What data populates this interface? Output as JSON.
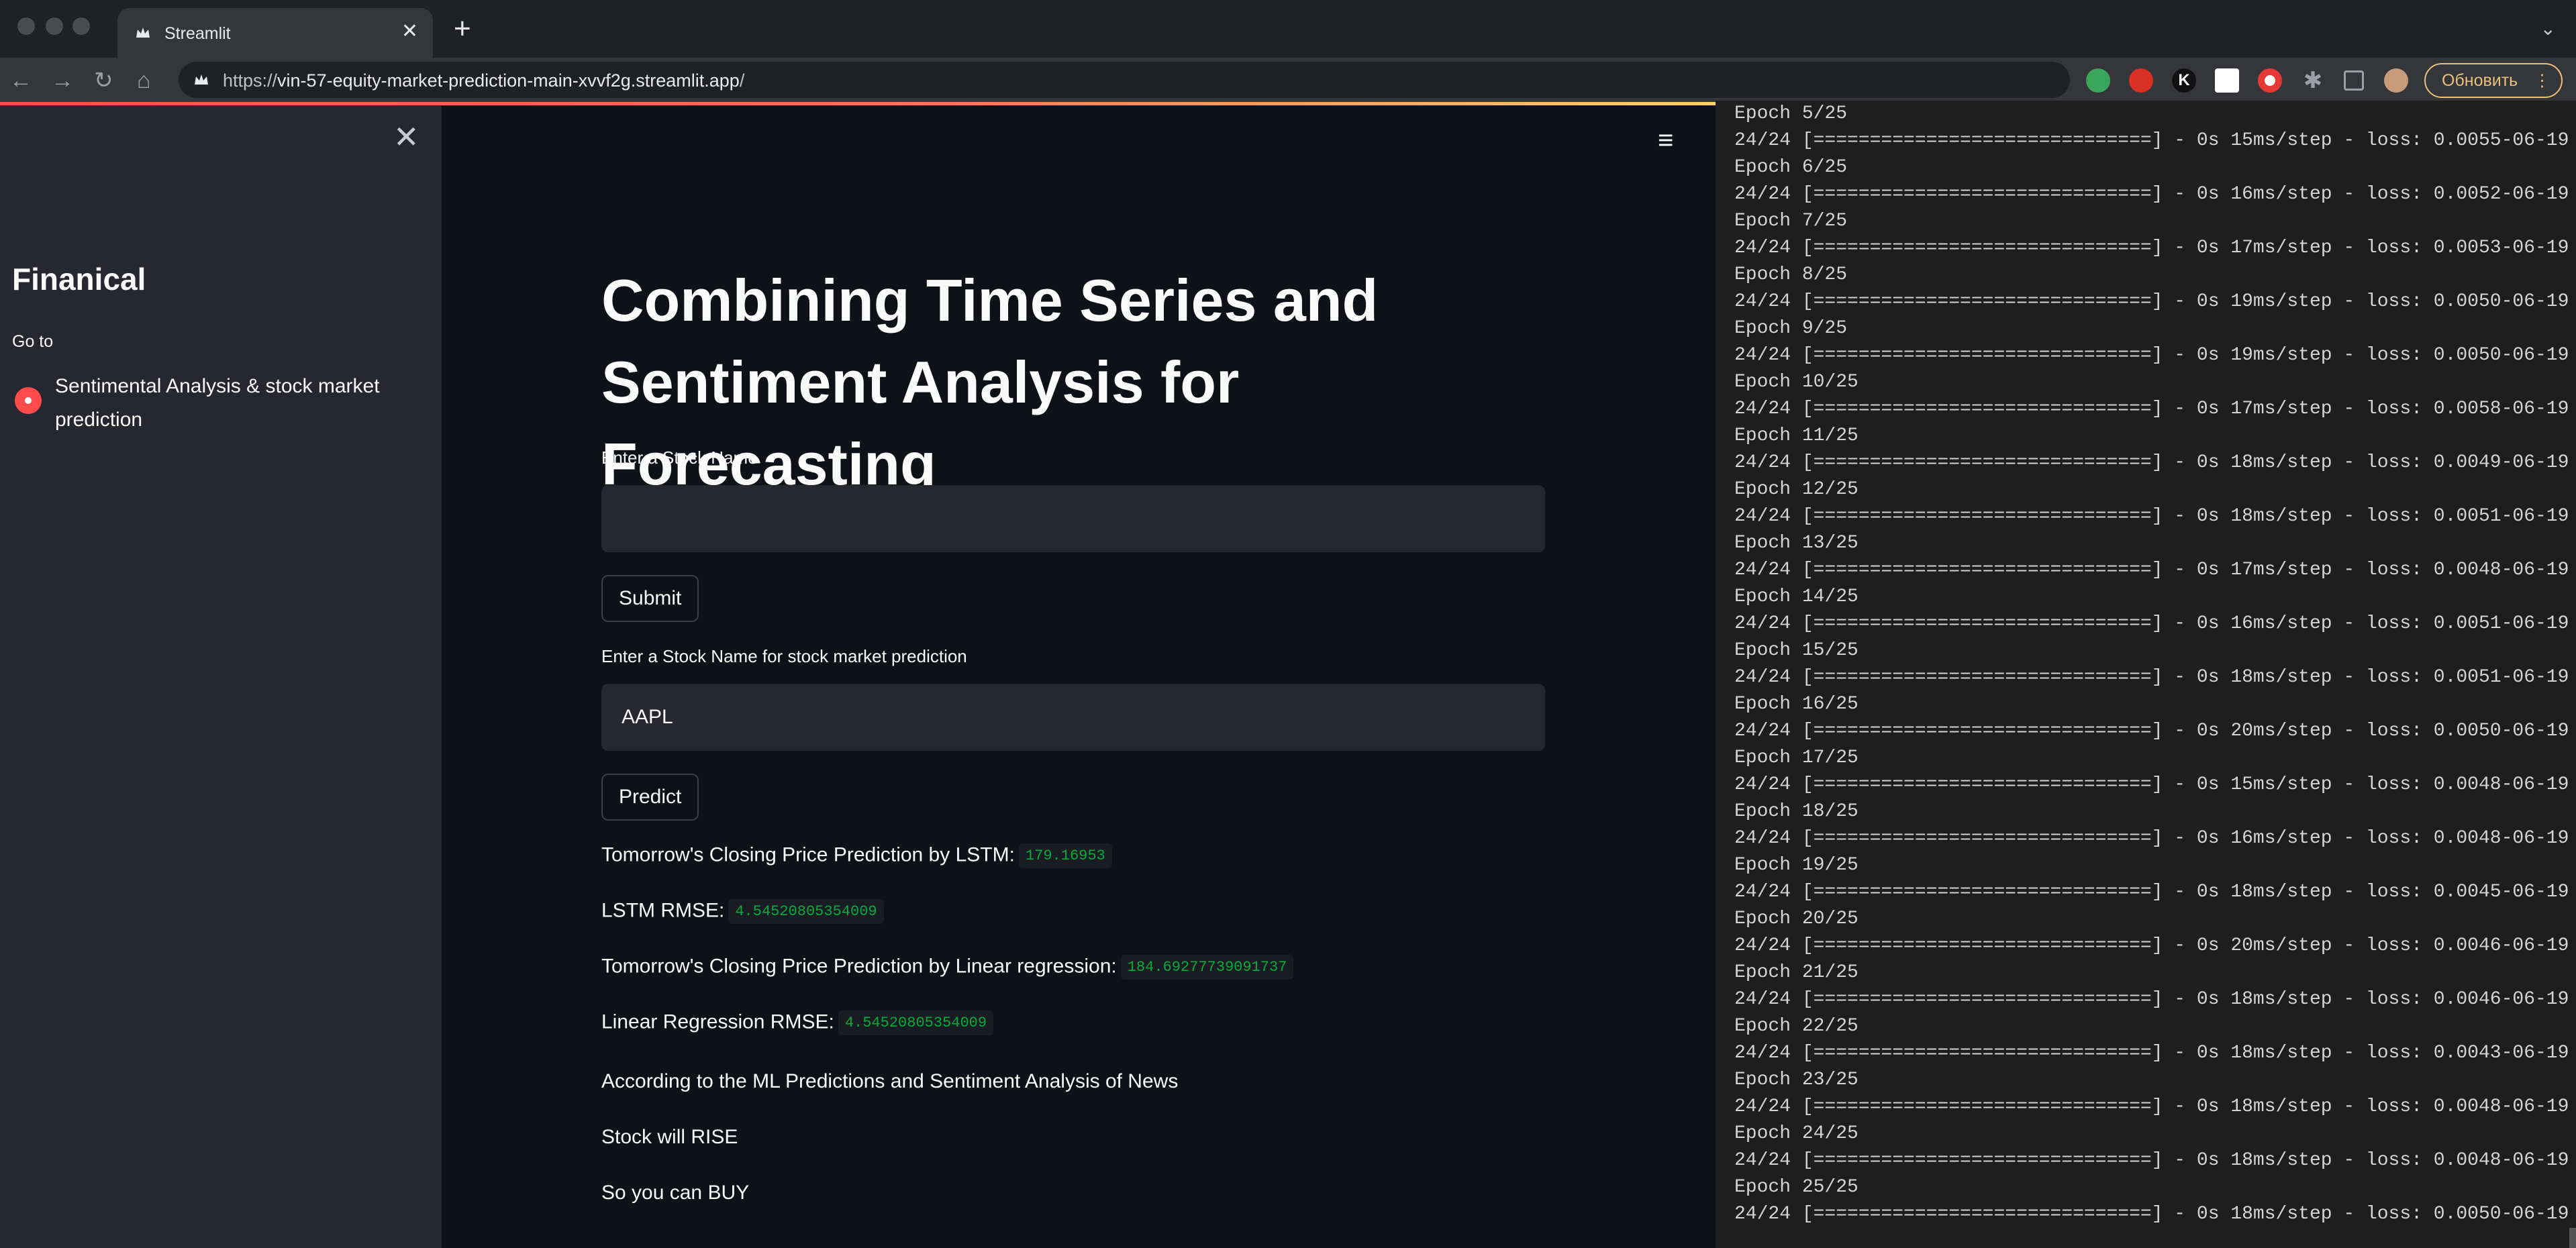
{
  "browser": {
    "tab_title": "Streamlit",
    "url_scheme": "https://",
    "url_host": "vin-57-equity-market-prediction-main-xvvf2g.streamlit.app",
    "url_path": "/",
    "update_label": "Обновить",
    "extensions": [
      "evernote-icon",
      "ext-red-icon",
      "ext-k-icon",
      "notion-icon",
      "ext-record-icon",
      "puzzle-icon",
      "sidepanel-icon",
      "profile-avatar"
    ]
  },
  "sidebar": {
    "title": "Finanical",
    "goto_label": "Go to",
    "options": [
      {
        "label": "Sentimental Analysis & stock market prediction",
        "selected": true
      }
    ]
  },
  "main": {
    "title": "Combining Time Series and Sentiment Analysis for Forecasting",
    "stock_name_label": "Enter a Stock Name",
    "stock_name_value": "",
    "submit_label": "Submit",
    "predict_input_label": "Enter a Stock Name for stock market prediction",
    "predict_input_value": "AAPL",
    "predict_label": "Predict",
    "results": {
      "lstm_pred_label": "Tomorrow's Closing Price Prediction by LSTM:",
      "lstm_pred_value": "179.16953",
      "lstm_rmse_label": "LSTM RMSE:",
      "lstm_rmse_value": "4.54520805354009",
      "lr_pred_label": "Tomorrow's Closing Price Prediction by Linear regression:",
      "lr_pred_value": "184.69277739091737",
      "lr_rmse_label": "Linear Regression RMSE:",
      "lr_rmse_value": "4.54520805354009",
      "summary_line": "According to the ML Predictions and Sentiment Analysis of News",
      "direction_line": "Stock will RISE",
      "advice_line": "So you can BUY"
    }
  },
  "terminal": {
    "lines": [
      "Epoch 5/25",
      "24/24 [==============================] - 0s 15ms/step - loss: 0.0055-06-19",
      "Epoch 6/25",
      "24/24 [==============================] - 0s 16ms/step - loss: 0.0052-06-19",
      "Epoch 7/25",
      "24/24 [==============================] - 0s 17ms/step - loss: 0.0053-06-19",
      "Epoch 8/25",
      "24/24 [==============================] - 0s 19ms/step - loss: 0.0050-06-19",
      "Epoch 9/25",
      "24/24 [==============================] - 0s 19ms/step - loss: 0.0050-06-19",
      "Epoch 10/25",
      "24/24 [==============================] - 0s 17ms/step - loss: 0.0058-06-19",
      "Epoch 11/25",
      "24/24 [==============================] - 0s 18ms/step - loss: 0.0049-06-19",
      "Epoch 12/25",
      "24/24 [==============================] - 0s 18ms/step - loss: 0.0051-06-19",
      "Epoch 13/25",
      "24/24 [==============================] - 0s 17ms/step - loss: 0.0048-06-19",
      "Epoch 14/25",
      "24/24 [==============================] - 0s 16ms/step - loss: 0.0051-06-19",
      "Epoch 15/25",
      "24/24 [==============================] - 0s 18ms/step - loss: 0.0051-06-19",
      "Epoch 16/25",
      "24/24 [==============================] - 0s 20ms/step - loss: 0.0050-06-19",
      "Epoch 17/25",
      "24/24 [==============================] - 0s 15ms/step - loss: 0.0048-06-19",
      "Epoch 18/25",
      "24/24 [==============================] - 0s 16ms/step - loss: 0.0048-06-19",
      "Epoch 19/25",
      "24/24 [==============================] - 0s 18ms/step - loss: 0.0045-06-19",
      "Epoch 20/25",
      "24/24 [==============================] - 0s 20ms/step - loss: 0.0046-06-19",
      "Epoch 21/25",
      "24/24 [==============================] - 0s 18ms/step - loss: 0.0046-06-19",
      "Epoch 22/25",
      "24/24 [==============================] - 0s 18ms/step - loss: 0.0043-06-19",
      "Epoch 23/25",
      "24/24 [==============================] - 0s 18ms/step - loss: 0.0048-06-19",
      "Epoch 24/25",
      "24/24 [==============================] - 0s 18ms/step - loss: 0.0048-06-19",
      "Epoch 25/25",
      "24/24 [==============================] - 0s 18ms/step - loss: 0.0050-06-19"
    ]
  },
  "colors": {
    "accent": "#ff4b4b",
    "code_text": "#09ab3b",
    "sidebar_bg": "#262730",
    "main_bg": "#0e1117",
    "terminal_bg": "#1e1e1e"
  }
}
